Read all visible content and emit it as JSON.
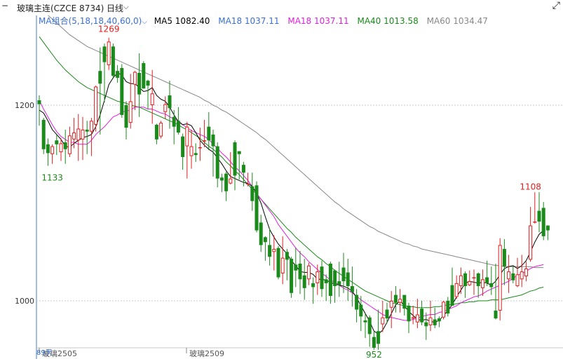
{
  "header": {
    "instrument": "玻璃主连(CZCE 8734)",
    "period": "日线"
  },
  "ma_bar": {
    "group": "MA组合(5,18,18,40,60,0)",
    "items": [
      {
        "label": "MA5 1082.40",
        "color": "#000000"
      },
      {
        "label": "MA18 1037.11",
        "color": "#3b6fd1"
      },
      {
        "label": "MA18 1037.11",
        "color": "#e020e0"
      },
      {
        "label": "MA40 1013.58",
        "color": "#1a8a1a"
      },
      {
        "label": "MA60 1034.47",
        "color": "#888888"
      }
    ]
  },
  "colors": {
    "up": "#e0201e",
    "down": "#1a8a1a",
    "grid": "#c8c8c8",
    "axis": "#4a78c0",
    "ma5": "#000000",
    "ma18": "#e020e0",
    "ma40": "#1a8a1a",
    "ma60": "#888888"
  },
  "chart_data": {
    "type": "candlestick",
    "y_ticks": [
      1200,
      1000
    ],
    "ylim": [
      943,
      1294
    ],
    "x_labels": [
      "玻璃2505",
      "玻璃2509"
    ],
    "bottom_label": "89天",
    "annotations": [
      {
        "text": "1269",
        "value": 1269,
        "at": "high",
        "candle": 16
      },
      {
        "text": "1133",
        "value": 1133,
        "at": "low",
        "candle": 3
      },
      {
        "text": "952",
        "value": 952,
        "at": "low",
        "candle": 77
      },
      {
        "text": "1108",
        "value": 1108,
        "at": "high",
        "candle": 113
      }
    ],
    "candles": [
      [
        1205,
        1201,
        1210,
        1179
      ],
      [
        1185,
        1155,
        1187,
        1150
      ],
      [
        1160,
        1151,
        1166,
        1138
      ],
      [
        1150,
        1158,
        1160,
        1140
      ],
      [
        1164,
        1160,
        1170,
        1149
      ],
      [
        1152,
        1161,
        1166,
        1143
      ],
      [
        1162,
        1155,
        1175,
        1140
      ],
      [
        1150,
        1169,
        1178,
        1147
      ],
      [
        1165,
        1172,
        1187,
        1156
      ],
      [
        1164,
        1176,
        1191,
        1143
      ],
      [
        1165,
        1175,
        1188,
        1144
      ],
      [
        1175,
        1173,
        1184,
        1150
      ],
      [
        1173,
        1184,
        1187,
        1148
      ],
      [
        1180,
        1219,
        1220,
        1173
      ],
      [
        1235,
        1222,
        1259,
        1170
      ],
      [
        1260,
        1244,
        1263,
        1203
      ],
      [
        1241,
        1265,
        1269,
        1236
      ],
      [
        1260,
        1230,
        1263,
        1227
      ],
      [
        1235,
        1228,
        1241,
        1223
      ],
      [
        1238,
        1190,
        1242,
        1187
      ],
      [
        1200,
        1177,
        1204,
        1165
      ],
      [
        1182,
        1204,
        1232,
        1176
      ],
      [
        1221,
        1234,
        1235,
        1195
      ],
      [
        1233,
        1211,
        1253,
        1188
      ],
      [
        1243,
        1217,
        1245,
        1217
      ],
      [
        1225,
        1220,
        1226,
        1196
      ],
      [
        1200,
        1212,
        1236,
        1181
      ],
      [
        1180,
        1165,
        1181,
        1160
      ],
      [
        1168,
        1182,
        1184,
        1166
      ],
      [
        1193,
        1201,
        1209,
        1186
      ],
      [
        1210,
        1197,
        1225,
        1176
      ],
      [
        1188,
        1178,
        1195,
        1160
      ],
      [
        1184,
        1172,
        1198,
        1170
      ],
      [
        1168,
        1147,
        1171,
        1134
      ],
      [
        1158,
        1178,
        1183,
        1125
      ],
      [
        1148,
        1158,
        1175,
        1135
      ],
      [
        1151,
        1149,
        1161,
        1142
      ],
      [
        1157,
        1157,
        1177,
        1143
      ],
      [
        1164,
        1164,
        1185,
        1157
      ],
      [
        1178,
        1164,
        1193,
        1154
      ],
      [
        1170,
        1158,
        1175,
        1127
      ],
      [
        1158,
        1125,
        1162,
        1116
      ],
      [
        1126,
        1123,
        1130,
        1111
      ],
      [
        1130,
        1112,
        1132,
        1102
      ],
      [
        1120,
        1125,
        1152,
        1119
      ],
      [
        1162,
        1128,
        1164,
        1113
      ],
      [
        1153,
        1150,
        1152,
        1124
      ],
      [
        1139,
        1131,
        1142,
        1117
      ],
      [
        1120,
        1120,
        1131,
        1117
      ],
      [
        1117,
        1102,
        1131,
        1092
      ],
      [
        1118,
        1072,
        1122,
        1070
      ],
      [
        1080,
        1057,
        1088,
        1050
      ],
      [
        1065,
        1060,
        1066,
        1041
      ],
      [
        1057,
        1045,
        1074,
        1036
      ],
      [
        1050,
        1053,
        1067,
        1031
      ],
      [
        1054,
        1024,
        1056,
        1022
      ],
      [
        1028,
        1044,
        1066,
        1017
      ],
      [
        1050,
        1042,
        1053,
        1021
      ],
      [
        1043,
        1008,
        1045,
        1003
      ],
      [
        1037,
        1031,
        1054,
        1014
      ],
      [
        1038,
        1022,
        1051,
        1007
      ],
      [
        1026,
        1013,
        1043,
        1001
      ],
      [
        1022,
        1036,
        1039,
        1016
      ],
      [
        1018,
        1014,
        1024,
        997
      ],
      [
        1018,
        1030,
        1037,
        1006
      ],
      [
        1035,
        1012,
        1041,
        1004
      ],
      [
        1022,
        1018,
        1027,
        1000
      ],
      [
        1038,
        1005,
        1040,
        997
      ],
      [
        1031,
        1015,
        1032,
        998
      ],
      [
        1020,
        1016,
        1040,
        1004
      ],
      [
        1034,
        1020,
        1049,
        1008
      ],
      [
        1029,
        1015,
        1043,
        1000
      ],
      [
        1015,
        1009,
        1035,
        994
      ],
      [
        1006,
        991,
        1012,
        978
      ],
      [
        996,
        984,
        1005,
        969
      ],
      [
        980,
        978,
        987,
        962
      ],
      [
        983,
        966,
        985,
        953
      ],
      [
        963,
        952,
        969,
        950
      ],
      [
        969,
        956,
        991,
        950
      ],
      [
        976,
        983,
        1000,
        968
      ],
      [
        991,
        982,
        998,
        977
      ],
      [
        993,
        1000,
        1010,
        972
      ],
      [
        1006,
        998,
        1015,
        988
      ],
      [
        998,
        1002,
        1012,
        988
      ],
      [
        1006,
        992,
        1004,
        985
      ],
      [
        995,
        979,
        998,
        967
      ],
      [
        983,
        983,
        995,
        976
      ],
      [
        978,
        986,
        1002,
        972
      ],
      [
        992,
        978,
        1000,
        975
      ],
      [
        978,
        974,
        988,
        960
      ],
      [
        975,
        983,
        1000,
        969
      ],
      [
        981,
        975,
        993,
        972
      ],
      [
        982,
        979,
        984,
        973
      ],
      [
        983,
        999,
        1000,
        981
      ],
      [
        1000,
        987,
        1004,
        984
      ],
      [
        1016,
        995,
        1034,
        996
      ],
      [
        1004,
        1018,
        1026,
        1002
      ],
      [
        1015,
        1026,
        1034,
        1007
      ],
      [
        1028,
        1015,
        1030,
        1003
      ],
      [
        1016,
        1020,
        1031,
        1015
      ],
      [
        1023,
        1024,
        1032,
        1006
      ],
      [
        1028,
        1015,
        1029,
        1003
      ],
      [
        1013,
        1022,
        1032,
        1005
      ],
      [
        1024,
        1018,
        1041,
        1015
      ],
      [
        1018,
        1014,
        1035,
        1006
      ],
      [
        990,
        982,
        1038,
        981
      ],
      [
        990,
        1057,
        1064,
        980
      ],
      [
        1053,
        1035,
        1063,
        1016
      ],
      [
        1022,
        1030,
        1047,
        1008
      ],
      [
        1028,
        1021,
        1036,
        1018
      ],
      [
        1015,
        1027,
        1044,
        1014
      ],
      [
        1022,
        1030,
        1047,
        1014
      ],
      [
        1025,
        1033,
        1040,
        1020
      ],
      [
        1042,
        1077,
        1096,
        1040
      ],
      [
        1080,
        1081,
        1111,
        1079
      ],
      [
        1092,
        1081,
        1111,
        1070
      ],
      [
        1095,
        1066,
        1101,
        1062
      ],
      [
        1077,
        1072,
        1077,
        1062
      ]
    ],
    "ma5": [
      1195,
      1192,
      1184,
      1175,
      1170,
      1165,
      1158,
      1157,
      1161,
      1164,
      1167,
      1168,
      1170,
      1178,
      1190,
      1205,
      1221,
      1228,
      1233,
      1231,
      1224,
      1222,
      1222,
      1218,
      1214,
      1215,
      1218,
      1210,
      1206,
      1204,
      1198,
      1190,
      1183,
      1180,
      1181,
      1179,
      1172,
      1164,
      1159,
      1155,
      1152,
      1146,
      1140,
      1133,
      1127,
      1125,
      1123,
      1121,
      1120,
      1117,
      1110,
      1100,
      1086,
      1073,
      1065,
      1058,
      1053,
      1048,
      1041,
      1036,
      1030,
      1029,
      1029,
      1027,
      1022,
      1022,
      1021,
      1019,
      1017,
      1016,
      1015,
      1013,
      1010,
      1003,
      995,
      987,
      979,
      969,
      966,
      970,
      978,
      987,
      996,
      1000,
      995,
      989,
      985,
      981,
      980,
      981,
      979,
      978,
      980,
      985,
      990,
      996,
      1004,
      1011,
      1018,
      1020,
      1019,
      1018,
      1019,
      1018,
      1016,
      1020,
      1027,
      1033,
      1035,
      1036,
      1033,
      1036,
      1041,
      1050,
      1060,
      1068,
      1072
    ],
    "ma18": [
      1205,
      1196,
      1188,
      1180,
      1173,
      1168,
      1165,
      1162,
      1162,
      1160,
      1160,
      1160,
      1164,
      1170,
      1174,
      1178,
      1183,
      1188,
      1190,
      1193,
      1194,
      1195,
      1198,
      1198,
      1198,
      1196,
      1196,
      1194,
      1192,
      1191,
      1188,
      1186,
      1184,
      1180,
      1177,
      1174,
      1172,
      1170,
      1168,
      1165,
      1160,
      1156,
      1151,
      1147,
      1142,
      1137,
      1133,
      1128,
      1123,
      1117,
      1110,
      1104,
      1098,
      1092,
      1086,
      1078,
      1072,
      1066,
      1060,
      1054,
      1049,
      1045,
      1040,
      1036,
      1032,
      1028,
      1025,
      1021,
      1019,
      1016,
      1013,
      1011,
      1008,
      1005,
      1001,
      998,
      995,
      992,
      989,
      986,
      984,
      983,
      982,
      981,
      980,
      980,
      981,
      982,
      984,
      985,
      986,
      986,
      988,
      989,
      991,
      993,
      995,
      998,
      1000,
      1002,
      1004,
      1005,
      1007,
      1010,
      1012,
      1014,
      1016,
      1018,
      1020,
      1023,
      1026,
      1028,
      1030,
      1033,
      1035,
      1036,
      1037
    ],
    "ma40": [
      1270,
      1264,
      1258,
      1252,
      1246,
      1241,
      1236,
      1232,
      1228,
      1224,
      1221,
      1218,
      1216,
      1214,
      1212,
      1210,
      1208,
      1206,
      1204,
      1203,
      1202,
      1200,
      1199,
      1198,
      1196,
      1194,
      1192,
      1190,
      1188,
      1186,
      1184,
      1182,
      1180,
      1177,
      1175,
      1172,
      1169,
      1166,
      1162,
      1158,
      1155,
      1151,
      1147,
      1142,
      1138,
      1133,
      1129,
      1124,
      1119,
      1114,
      1109,
      1104,
      1099,
      1094,
      1089,
      1084,
      1079,
      1074,
      1070,
      1065,
      1061,
      1057,
      1053,
      1049,
      1045,
      1042,
      1038,
      1035,
      1031,
      1028,
      1025,
      1022,
      1019,
      1016,
      1013,
      1010,
      1008,
      1006,
      1004,
      1002,
      1000,
      998,
      997,
      996,
      995,
      994,
      994,
      993,
      993,
      993,
      993,
      994,
      994,
      995,
      996,
      996,
      997,
      998,
      998,
      999,
      999,
      1000,
      1000,
      1000,
      1001,
      1001,
      1001,
      1002,
      1003,
      1004,
      1005,
      1006,
      1008,
      1010,
      1011,
      1013,
      1014
    ],
    "ma60": [
      1300,
      1296,
      1292,
      1288,
      1284,
      1280,
      1276,
      1272,
      1269,
      1266,
      1263,
      1260,
      1258,
      1256,
      1254,
      1252,
      1250,
      1248,
      1246,
      1244,
      1242,
      1240,
      1238,
      1236,
      1234,
      1232,
      1230,
      1228,
      1226,
      1224,
      1222,
      1220,
      1218,
      1216,
      1214,
      1212,
      1210,
      1208,
      1205,
      1203,
      1200,
      1198,
      1195,
      1193,
      1190,
      1187,
      1184,
      1181,
      1178,
      1175,
      1172,
      1168,
      1165,
      1161,
      1157,
      1153,
      1149,
      1145,
      1141,
      1137,
      1133,
      1129,
      1125,
      1121,
      1117,
      1113,
      1109,
      1105,
      1101,
      1098,
      1094,
      1091,
      1088,
      1085,
      1082,
      1079,
      1076,
      1074,
      1071,
      1069,
      1067,
      1065,
      1063,
      1061,
      1059,
      1058,
      1056,
      1055,
      1053,
      1052,
      1051,
      1050,
      1049,
      1048,
      1047,
      1046,
      1045,
      1044,
      1043,
      1042,
      1041,
      1040,
      1039,
      1038,
      1037,
      1036,
      1036,
      1035,
      1035,
      1035,
      1035,
      1035,
      1035,
      1035,
      1034,
      1034,
      1034
    ]
  }
}
